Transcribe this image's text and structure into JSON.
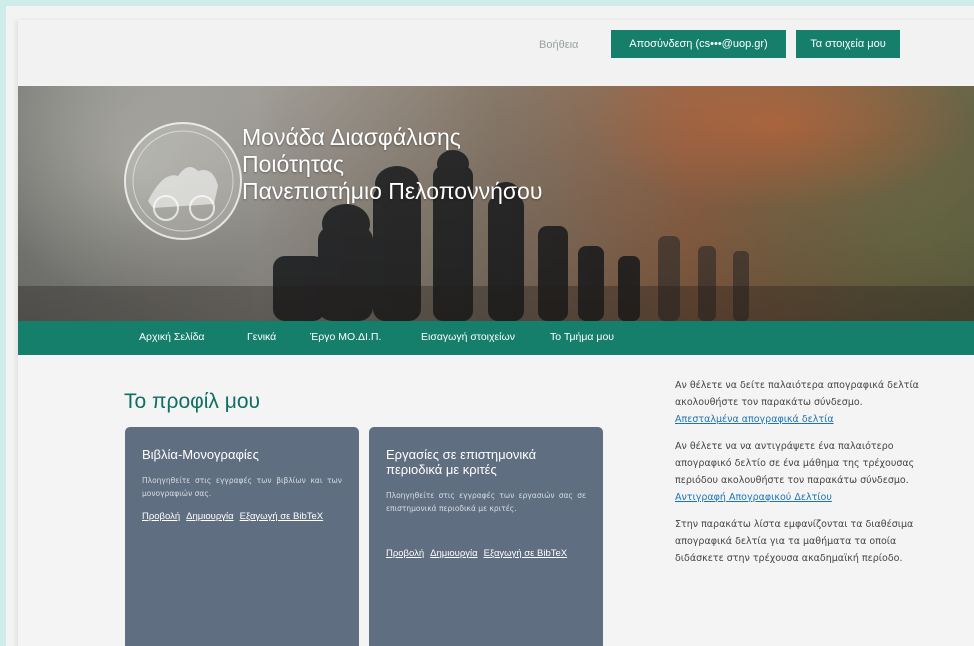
{
  "topbar": {
    "help": "Βοήθεια",
    "logout": "Αποσύνδεση (cs•••@uop.gr)",
    "my_data": "Τα στοιχεία μου"
  },
  "hero": {
    "title_lines": [
      "Μονάδα Διασφάλισης",
      "Ποιότητας",
      "Πανεπιστήμιο Πελοποννήσου"
    ]
  },
  "nav": {
    "items": [
      "Αρχική Σελίδα",
      "Γενικά",
      "Έργο ΜΟ.ΔΙ.Π.",
      "Εισαγωγή στοιχείων",
      "Το Τμήμα μου"
    ]
  },
  "main": {
    "title": "Το προφίλ μου",
    "cards": [
      {
        "title": "Βιβλία-Μονογραφίες",
        "description": "Πλοηγηθείτε στις εγγραφές των βιβλίων και των μονογραφιών σας.",
        "links": [
          "Προβολή",
          "Δημιουργία",
          "Εξαγωγή σε BibTeX"
        ]
      },
      {
        "title": "Εργασίες σε επιστημονικά περιοδικά με κριτές",
        "description": "Πλοηγηθείτε στις εγγραφές των εργασιών σας σε επιστημονικά περιοδικά με κριτές.",
        "links": [
          "Προβολή",
          "Δημιουργία",
          "Εξαγωγή σε BibTeX"
        ]
      }
    ]
  },
  "sidebar": {
    "p1": "Αν θέλετε να δείτε παλαιότερα απογραφικά δελτία ακολουθήστε τον παρακάτω σύνδεσμο.",
    "link1": "Απεσταλμένα απογραφικά δελτία",
    "p2": "Αν θέλετε να να αντιγράψετε ένα παλαιότερο απογραφικό δελτίο σε ένα μάθημα της τρέχουσας περιόδου ακολουθήστε τον παρακάτω σύνδεσμο.",
    "link2": "Αντιγραφή Απογραφικού Δελτίου",
    "p3": "Στην παρακάτω λίστα εμφανίζονται τα διαθέσιμα απογραφικά δελτία για τα μαθήματα τα οποία διδάσκετε στην τρέχουσα ακαδημαϊκή περίοδο."
  },
  "colors": {
    "accent": "#167f6c",
    "card_bg": "#5f6e80",
    "title_green": "#0f6f64",
    "link_blue": "#1c73b8"
  }
}
